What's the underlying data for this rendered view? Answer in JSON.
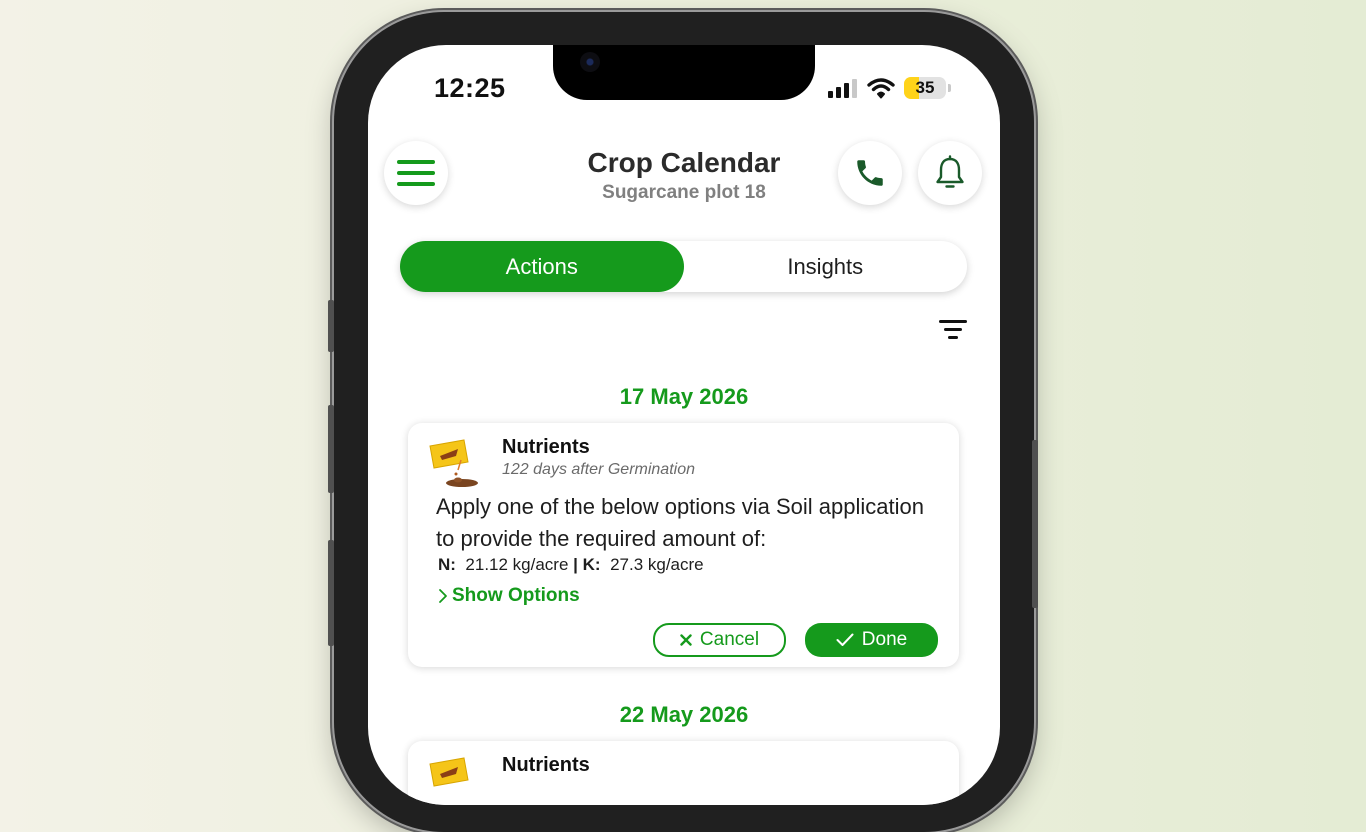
{
  "status_bar": {
    "time": "12:25",
    "battery": "35",
    "battery_level": 0.35
  },
  "header": {
    "title": "Crop Calendar",
    "subtitle": "Sugarcane plot 18",
    "menu_icon": "hamburger-menu-icon",
    "call_icon": "phone-icon",
    "notifications_icon": "bell-icon"
  },
  "tabs": [
    {
      "label": "Actions",
      "active": true
    },
    {
      "label": "Insights",
      "active": false
    }
  ],
  "filter_icon": "filter-icon",
  "colors": {
    "accent": "#159a1c",
    "battery": "#ffd31a"
  },
  "entries": [
    {
      "date": "17 May 2026",
      "card": {
        "icon": "fertilizer-bag-icon",
        "title": "Nutrients",
        "subtitle": "122 days after Germination",
        "body": "Apply one of the below options via Soil application to provide the required amount of:",
        "n_label": "N:",
        "n_value": "21.12 kg/acre",
        "separator": "|",
        "k_label": "K:",
        "k_value": "27.3 kg/acre",
        "show_options": "Show Options",
        "cancel": "Cancel",
        "done": "Done"
      }
    },
    {
      "date": "22 May 2026",
      "card": {
        "icon": "fertilizer-bag-icon",
        "title": "Nutrients"
      }
    }
  ]
}
